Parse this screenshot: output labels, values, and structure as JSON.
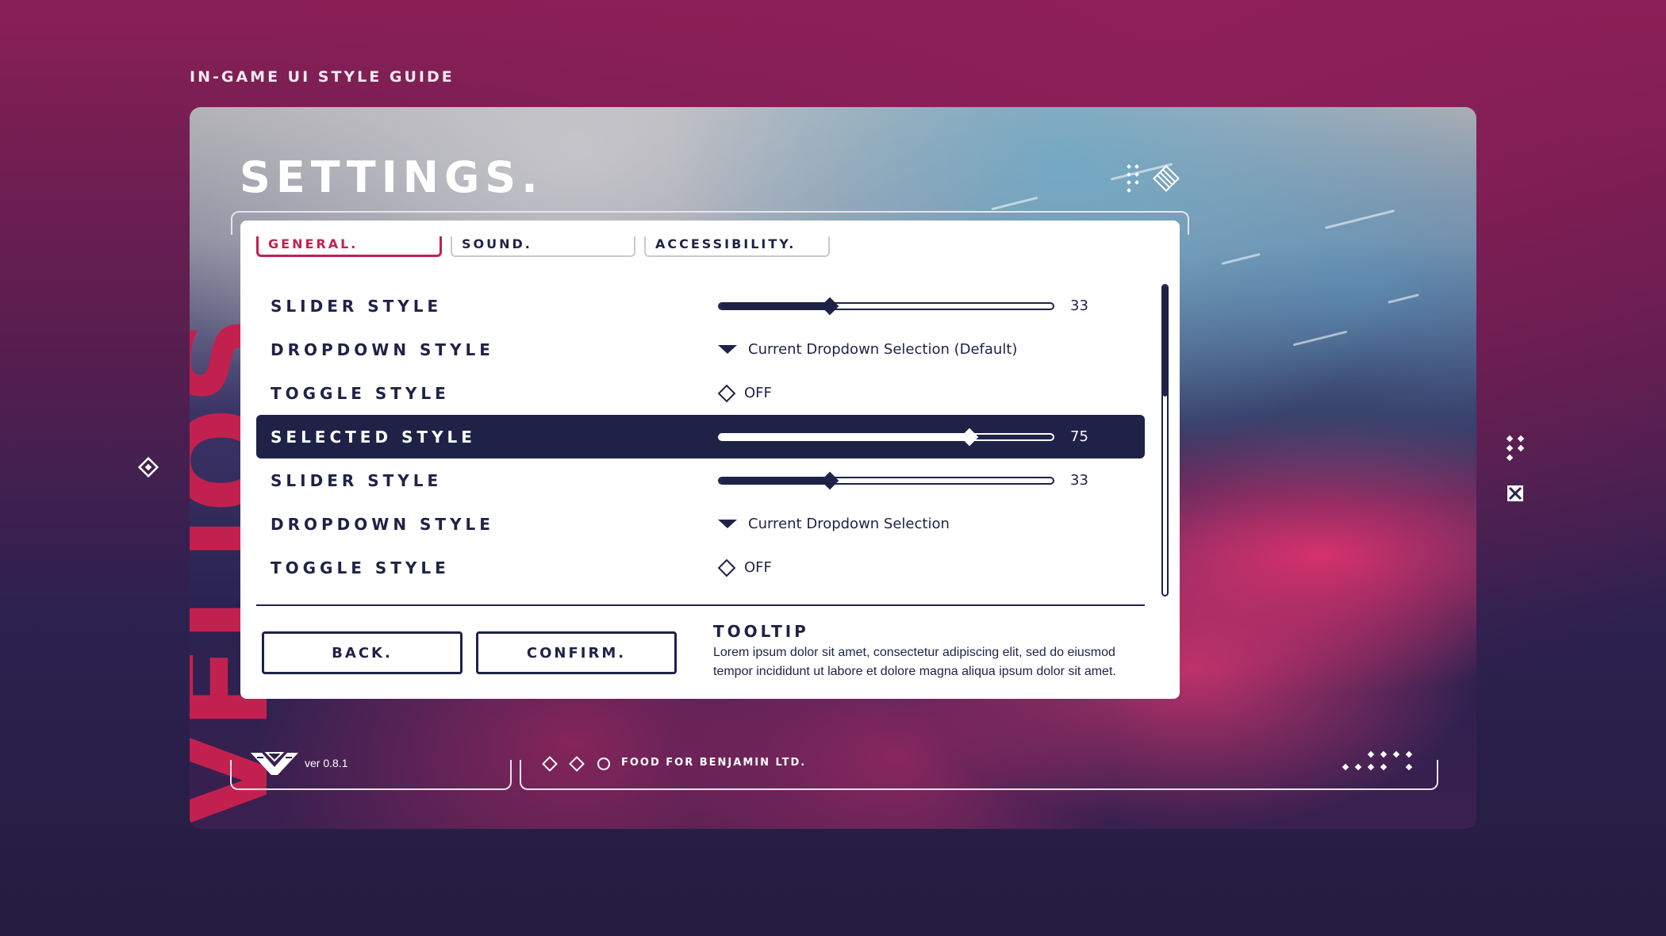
{
  "page": {
    "style_guide_title": "IN-GAME UI STYLE GUIDE",
    "vertical_text": "VELIOS",
    "settings_title": "SETTINGS."
  },
  "tabs": [
    {
      "label": "GENERAL.",
      "active": true
    },
    {
      "label": "SOUND.",
      "active": false
    },
    {
      "label": "ACCESSIBILITY.",
      "active": false
    }
  ],
  "rows": [
    {
      "label": "SLIDER STYLE",
      "type": "slider",
      "value": "33",
      "level": 0.33,
      "selected": false
    },
    {
      "label": "DROPDOWN STYLE",
      "type": "dropdown",
      "value": "Current Dropdown Selection (Default)",
      "selected": false
    },
    {
      "label": "TOGGLE STYLE",
      "type": "toggle",
      "value": "OFF",
      "selected": false
    },
    {
      "label": "SELECTED STYLE",
      "type": "slider",
      "value": "75",
      "level": 0.75,
      "selected": true
    },
    {
      "label": "SLIDER STYLE",
      "type": "slider",
      "value": "33",
      "level": 0.33,
      "selected": false
    },
    {
      "label": "DROPDOWN STYLE",
      "type": "dropdown",
      "value": "Current Dropdown Selection",
      "selected": false
    },
    {
      "label": "TOGGLE STYLE",
      "type": "toggle",
      "value": "OFF",
      "selected": false
    }
  ],
  "buttons": {
    "back": "BACK.",
    "confirm": "CONFIRM."
  },
  "tooltip": {
    "title": "TOOLTIP",
    "body": "Lorem ipsum dolor sit amet, consectetur adipiscing elit, sed do eiusmod tempor incididunt ut labore et dolore magna aliqua ipsum dolor sit amet."
  },
  "footer": {
    "version": "ver 0.8.1",
    "company": "FOOD FOR BENJAMIN LTD."
  },
  "colors": {
    "navy": "#1f2247",
    "accent_red": "#c2214f",
    "panel_bg": "#ffffff"
  },
  "icons": [
    "diamond-nav-left-icon",
    "dots-grid-icon",
    "close-x-icon",
    "brand-logo-icon",
    "hatched-diamond-icon"
  ]
}
